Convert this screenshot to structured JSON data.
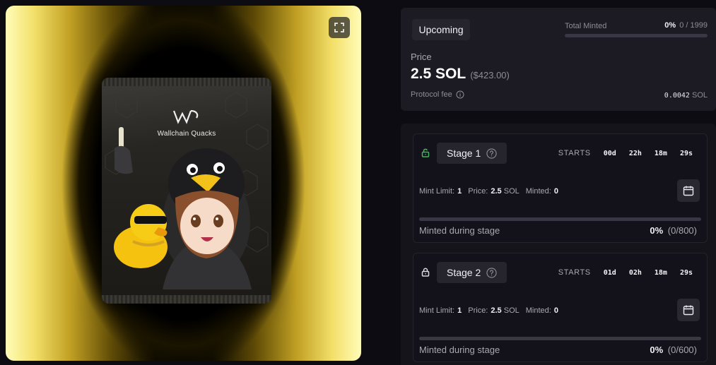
{
  "art": {
    "pack_title": "Wallchain Quacks",
    "expand_icon": "expand-icon"
  },
  "mint": {
    "status": "Upcoming",
    "total_minted_label": "Total Minted",
    "total_minted_pct": "0%",
    "total_minted_count": "0 / 1999",
    "total_minted_progress": 0,
    "price_label": "Price",
    "price_sol": "2.5 SOL",
    "price_usd": "($423.00)",
    "protocol_fee_label": "Protocol fee",
    "protocol_fee_value": "0.0042",
    "protocol_fee_unit": "SOL"
  },
  "stages": [
    {
      "name": "Stage 1",
      "lock_state": "unlocked",
      "lock_color": "#3bb75e",
      "starts_label": "STARTS",
      "days": "00d",
      "hours": "22h",
      "minutes": "18m",
      "seconds": "29s",
      "mint_limit_label": "Mint Limit:",
      "mint_limit": "1",
      "price_label": "Price:",
      "price": "2.5",
      "price_unit": "SOL",
      "minted_label": "Minted:",
      "minted": "0",
      "minted_during_label": "Minted during stage",
      "minted_pct": "0%",
      "minted_ratio": "(0/800)",
      "progress": 0
    },
    {
      "name": "Stage 2",
      "lock_state": "locked",
      "lock_color": "#d8d7de",
      "starts_label": "STARTS",
      "days": "01d",
      "hours": "02h",
      "minutes": "18m",
      "seconds": "29s",
      "mint_limit_label": "Mint Limit:",
      "mint_limit": "1",
      "price_label": "Price:",
      "price": "2.5",
      "price_unit": "SOL",
      "minted_label": "Minted:",
      "minted": "0",
      "minted_during_label": "Minted during stage",
      "minted_pct": "0%",
      "minted_ratio": "(0/600)",
      "progress": 0
    }
  ]
}
